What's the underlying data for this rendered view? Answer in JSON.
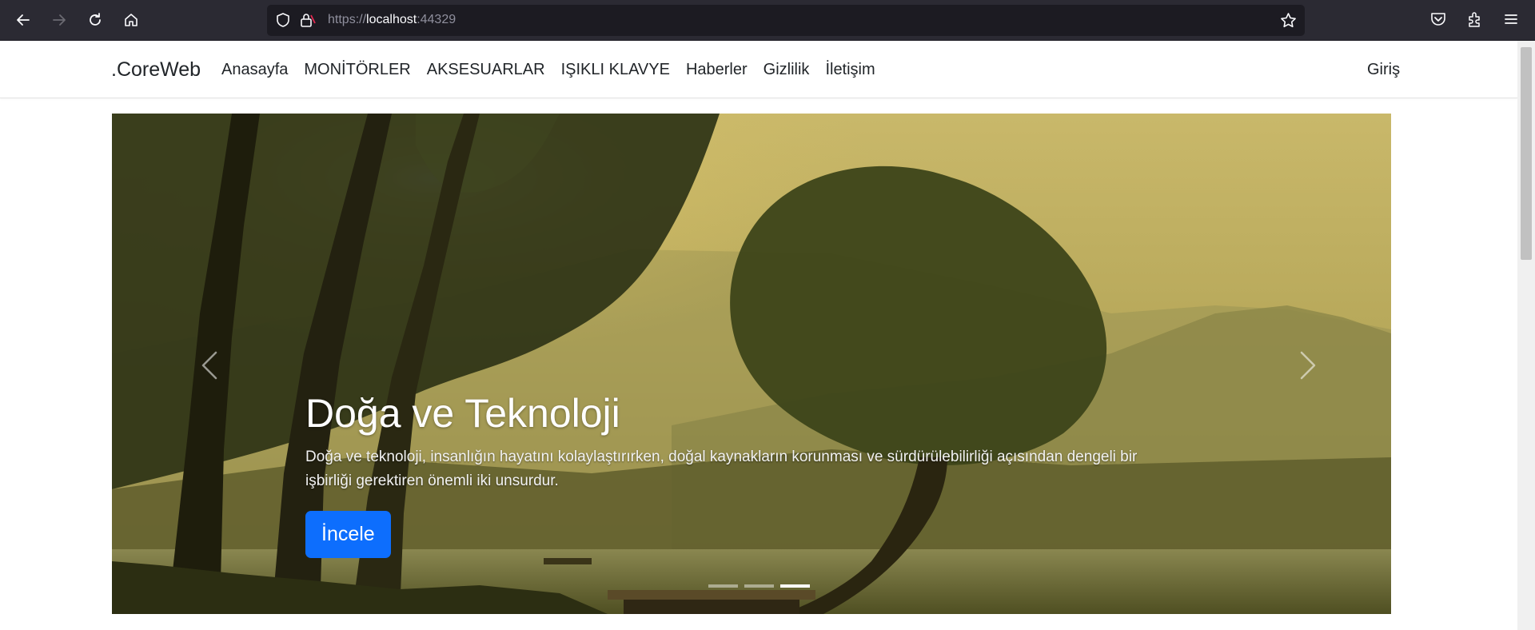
{
  "browser": {
    "url_scheme": "https://",
    "url_host": "localhost",
    "url_port": ":44329"
  },
  "navbar": {
    "brand": ".CoreWeb",
    "items": [
      {
        "label": "Anasayfa"
      },
      {
        "label": "MONİTÖRLER"
      },
      {
        "label": "AKSESUARLAR"
      },
      {
        "label": "IŞIKLI KLAVYE"
      },
      {
        "label": "Haberler"
      },
      {
        "label": "Gizlilik"
      },
      {
        "label": "İletişim"
      }
    ],
    "login": "Giriş"
  },
  "carousel": {
    "title": "Doğa ve Teknoloji",
    "text": "Doğa ve teknoloji, insanlığın hayatını kolaylaştırırken, doğal kaynakların korunması ve sürdürülebilirliği açısından dengeli bir işbirliği gerektiren önemli iki unsurdur.",
    "button": "İncele",
    "slide_count": 3,
    "active_slide": 3
  },
  "colors": {
    "chrome": "#2b2a33",
    "accent": "#0d6efd",
    "text": "#212529"
  },
  "icons": [
    "back-icon",
    "forward-icon",
    "reload-icon",
    "home-icon",
    "shield-icon",
    "lock-icon",
    "star-icon",
    "pocket-icon",
    "extensions-icon",
    "menu-icon",
    "chevron-left-icon",
    "chevron-right-icon"
  ]
}
